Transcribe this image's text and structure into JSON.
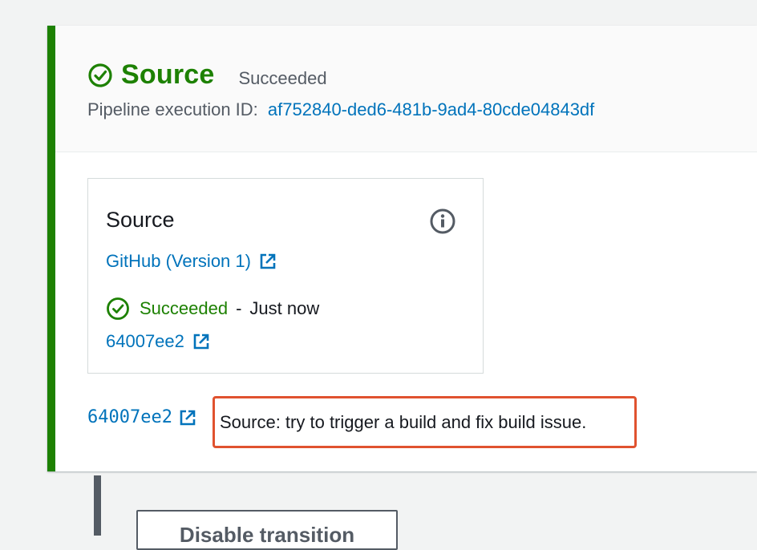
{
  "stage": {
    "name": "Source",
    "status": "Succeeded",
    "execution_label": "Pipeline execution ID:",
    "execution_id": "af752840-ded6-481b-9ad4-80cde04843df",
    "accent_color": "#1d8102",
    "status_icon": "check-circle-icon"
  },
  "action": {
    "title": "Source",
    "info_icon": "info-icon",
    "provider": "GitHub (Version 1)",
    "status": "Succeeded",
    "separator": "-",
    "time": "Just now",
    "commit": "64007ee2"
  },
  "commit_row": {
    "commit_id": "64007ee2",
    "message": "Source: try to trigger a build and fix build issue.",
    "highlight_color": "#e0522f"
  },
  "transition": {
    "button_label": "Disable transition"
  }
}
